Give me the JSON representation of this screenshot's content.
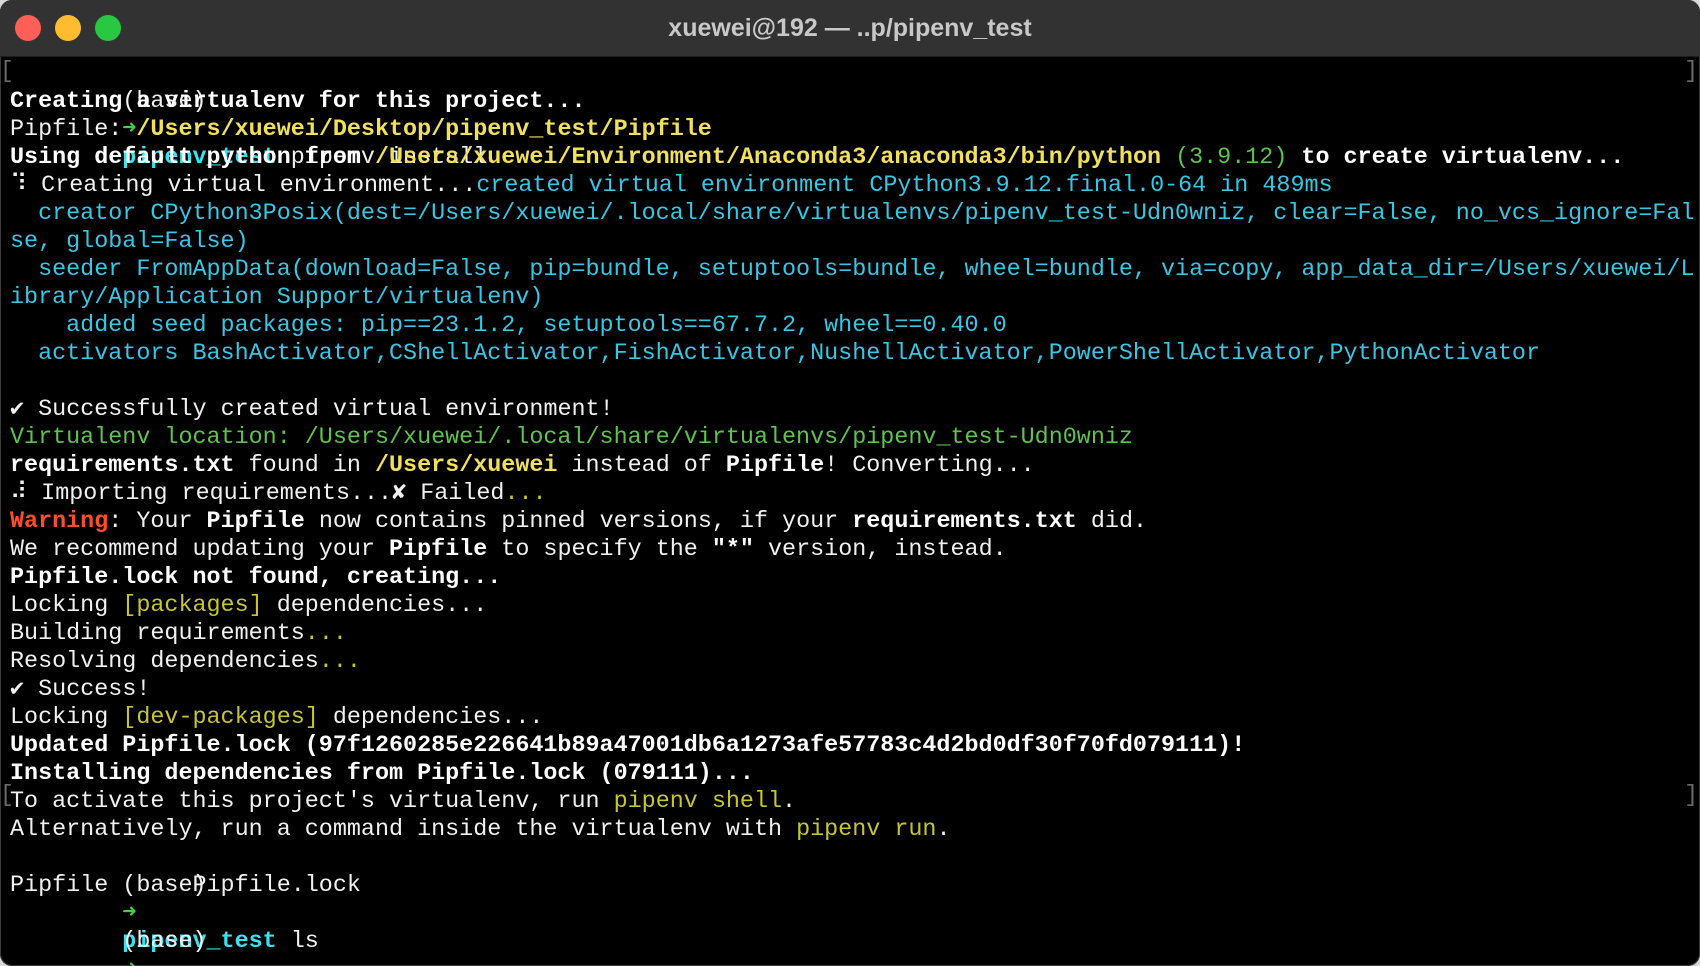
{
  "window": {
    "title": "xuewei@192 — ..p/pipenv_test"
  },
  "terminal": {
    "l1": {
      "env": "(base)",
      "arrow": "➜",
      "dir": "pipenv_test",
      "cmd": " pipenv install"
    },
    "l2": "Creating a virtualenv for this project...",
    "l3": {
      "a": "Pipfile: ",
      "b": "/Users/xuewei/Desktop/pipenv_test/Pipfile"
    },
    "l4": {
      "a": "Using default python from ",
      "b": "/Users/xuewei/Environment/Anaconda3/anaconda3/bin/python",
      "c": " (3.9.12)",
      "d": " to create virtualenv..."
    },
    "l5": {
      "a": "⠹ Creating virtual environment...",
      "b": "created virtual environment CPython3.9.12.final.0-64 in 489ms"
    },
    "l6": "  creator CPython3Posix(dest=/Users/xuewei/.local/share/virtualenvs/pipenv_test-Udn0wniz, clear=False, no_vcs_ignore=Fal",
    "l7": "se, global=False)",
    "l8": "  seeder FromAppData(download=False, pip=bundle, setuptools=bundle, wheel=bundle, via=copy, app_data_dir=/Users/xuewei/L",
    "l9": "ibrary/Application Support/virtualenv)",
    "l10": "    added seed packages: pip==23.1.2, setuptools==67.7.2, wheel==0.40.0",
    "l11": "  activators BashActivator,CShellActivator,FishActivator,NushellActivator,PowerShellActivator,PythonActivator",
    "l13": "✔ Successfully created virtual environment!",
    "l14": "Virtualenv location: /Users/xuewei/.local/share/virtualenvs/pipenv_test-Udn0wniz",
    "l15": {
      "a": "requirements.txt",
      "b": " found in ",
      "c": "/Users/xuewei",
      "d": " instead of ",
      "e": "Pipfile",
      "f": "! Converting..."
    },
    "l16": {
      "a": "⠼ Importing requirements...✘ Failed",
      "b": "..."
    },
    "l17": {
      "a": "Warning",
      "b": ": Your ",
      "c": "Pipfile",
      "d": " now contains pinned versions, if your ",
      "e": "requirements.txt",
      "f": " did."
    },
    "l18": {
      "a": "We recommend updating your ",
      "b": "Pipfile",
      "c": " to specify the ",
      "d": "\"*\"",
      "e": " version, instead."
    },
    "l19": "Pipfile.lock not found, creating...",
    "l20": {
      "a": "Locking ",
      "b": "[packages]",
      "c": " dependencies..."
    },
    "l21": {
      "a": "Building requirements",
      "b": "..."
    },
    "l22": {
      "a": "Resolving dependencies",
      "b": "..."
    },
    "l23": "✔ Success!",
    "l24": {
      "a": "Locking ",
      "b": "[dev-packages]",
      "c": " dependencies..."
    },
    "l25": "Updated Pipfile.lock (97f1260285e226641b89a47001db6a1273afe57783c4d2bd0df30f70fd079111)!",
    "l26": "Installing dependencies from Pipfile.lock (079111)...",
    "l27": {
      "a": "To activate this project's virtualenv, run ",
      "b": "pipenv shell",
      "c": "."
    },
    "l28": {
      "a": "Alternatively, run a command inside the virtualenv with ",
      "b": "pipenv run",
      "c": "."
    },
    "l29": {
      "env": "(base)",
      "arrow": "➜",
      "dir": "pipenv_test",
      "cmd": " ls"
    },
    "l30": "Pipfile      Pipfile.lock",
    "l31": {
      "env": "(base)",
      "arrow": "➜",
      "dir": "pipenv_test",
      "cmd": " "
    }
  },
  "colors": {
    "prompt_dir": "#38e2f0",
    "path_yellow": "#f1e05a",
    "info_cyan": "#32c8e6",
    "location_green": "#5cc34b",
    "warning_red": "#ff4d2b"
  }
}
